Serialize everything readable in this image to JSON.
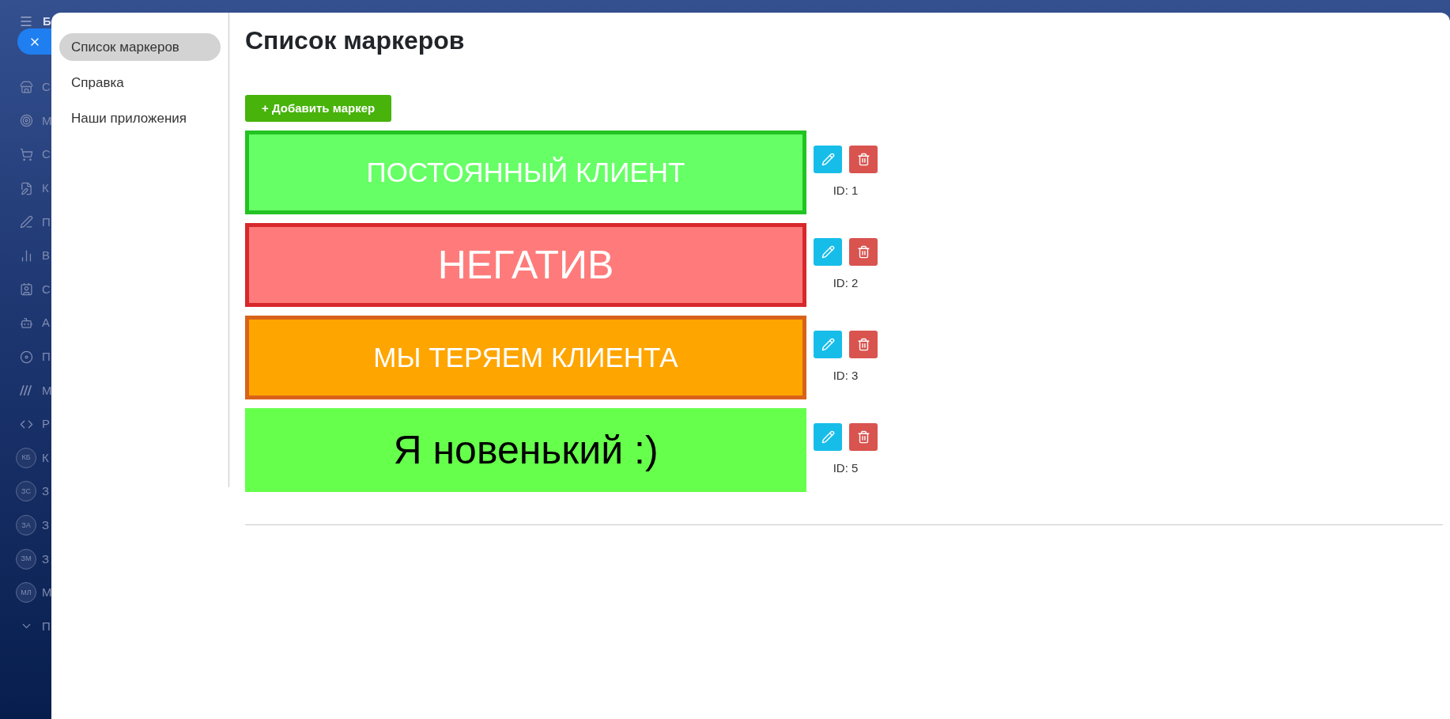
{
  "background_app": {
    "title_letter": "Б",
    "items": [
      {
        "kind": "icon",
        "label": "С"
      },
      {
        "kind": "icon",
        "label": "М"
      },
      {
        "kind": "icon",
        "label": "С"
      },
      {
        "kind": "icon",
        "label": "К"
      },
      {
        "kind": "icon",
        "label": "П"
      },
      {
        "kind": "icon",
        "label": "В"
      },
      {
        "kind": "icon",
        "label": "С"
      },
      {
        "kind": "icon",
        "label": "А"
      },
      {
        "kind": "icon",
        "label": "П"
      },
      {
        "kind": "icon",
        "label": "М"
      },
      {
        "kind": "icon",
        "label": "Р"
      },
      {
        "kind": "badge",
        "badge": "КБ",
        "label": "К"
      },
      {
        "kind": "badge",
        "badge": "ЗС",
        "label": "З"
      },
      {
        "kind": "badge",
        "badge": "ЗА",
        "label": "З"
      },
      {
        "kind": "badge",
        "badge": "ЗМ",
        "label": "З"
      },
      {
        "kind": "badge",
        "badge": "МЛ",
        "label": "М"
      },
      {
        "kind": "icon",
        "label": "П"
      }
    ]
  },
  "modal": {
    "sidebar": {
      "items": [
        {
          "label": "Список маркеров",
          "selected": true
        },
        {
          "label": "Справка",
          "selected": false
        },
        {
          "label": "Наши приложения",
          "selected": false
        }
      ]
    },
    "title": "Список маркеров",
    "add_button": "+ Добавить маркер",
    "markers": [
      {
        "label": "ПОСТОЯННЫЙ КЛИЕНТ",
        "color": "#66ff66",
        "border": {
          "color": "#22c322"
        },
        "text": {
          "color": "#ffffff"
        },
        "large": false,
        "id_label": "ID: 1"
      },
      {
        "label": "НЕГАТИВ",
        "color": "#ff7b7b",
        "border": {
          "color": "#d7282c"
        },
        "text": {
          "color": "#ffffff"
        },
        "large": true,
        "id_label": "ID: 2"
      },
      {
        "label": "МЫ ТЕРЯЕМ КЛИЕНТА",
        "color": "#ffa500",
        "border": {
          "color": "#d8621a"
        },
        "text": {
          "color": "#ffffff"
        },
        "large": false,
        "id_label": "ID: 3"
      },
      {
        "label": "Я новенький :)",
        "color": "#66ff4c",
        "text": {
          "color": "#000000"
        },
        "large": true,
        "id_label": "ID: 5"
      }
    ]
  }
}
